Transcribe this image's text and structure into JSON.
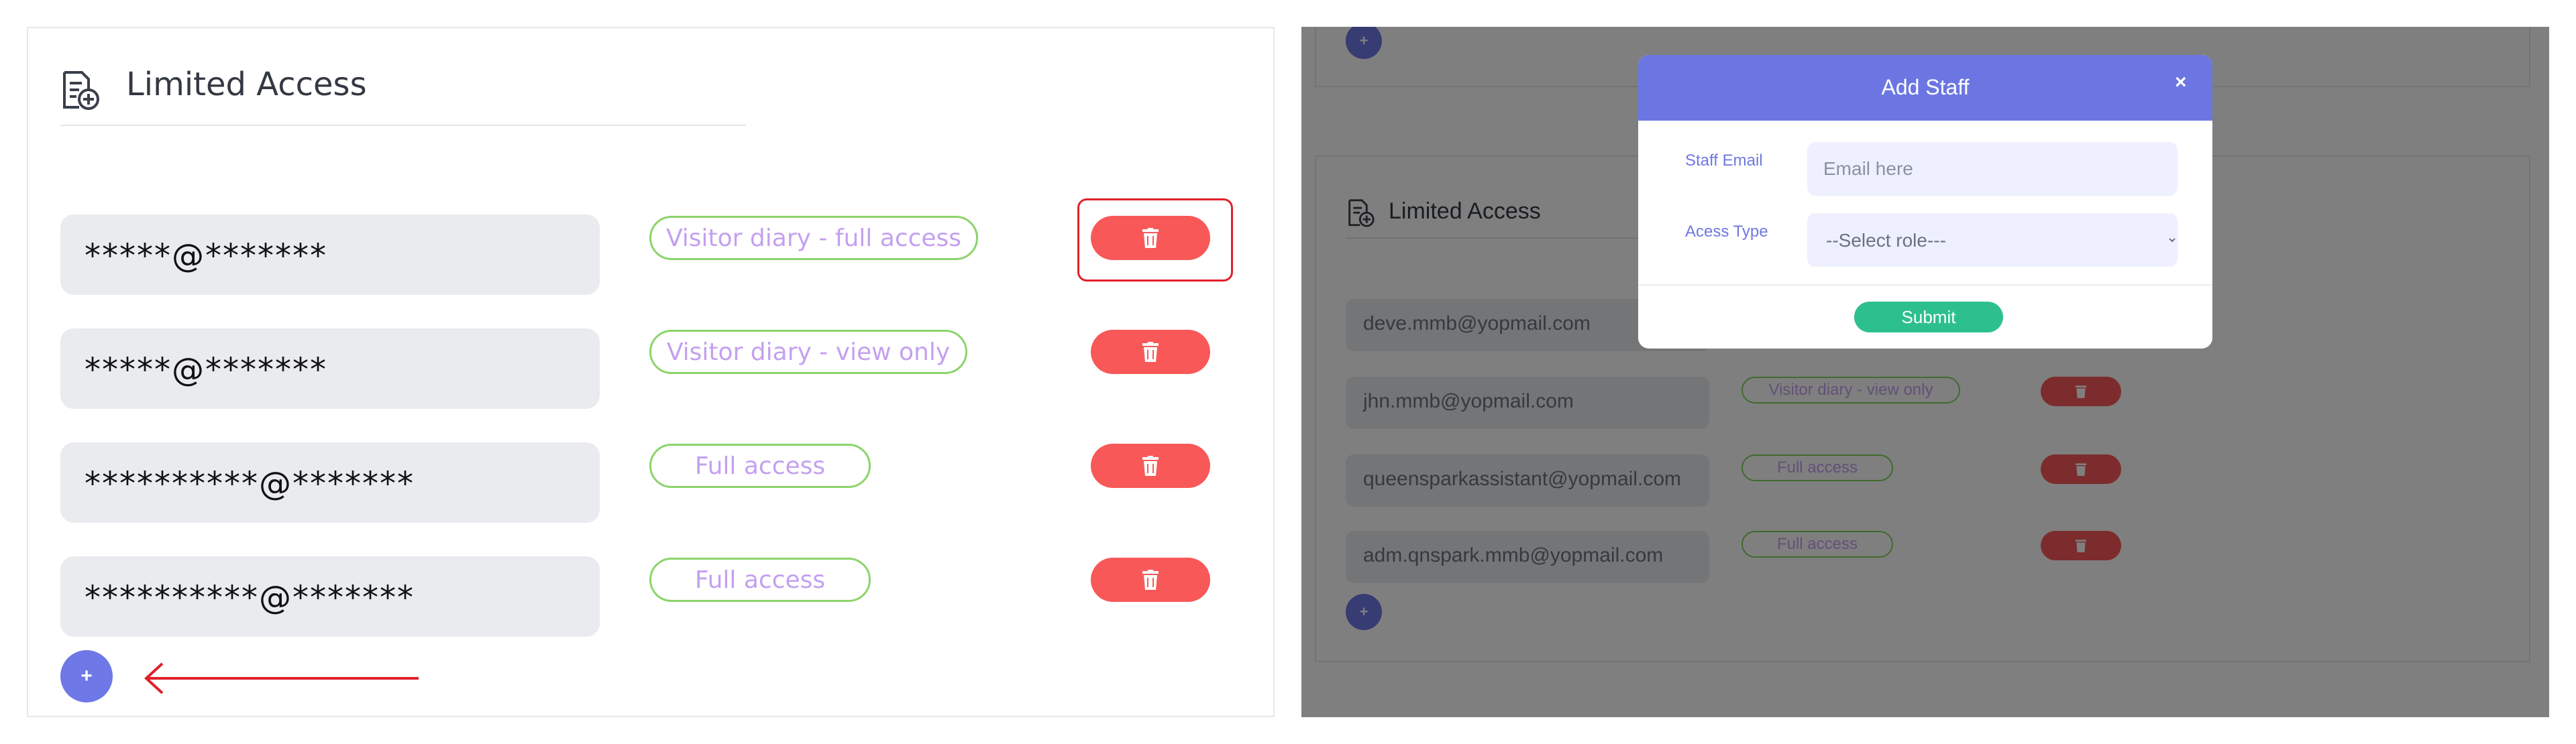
{
  "left": {
    "title": "Limited Access",
    "rows": [
      {
        "email": "*****@*******",
        "access": "Visitor diary - full access"
      },
      {
        "email": "*****@*******",
        "access": "Visitor diary - view only"
      },
      {
        "email": "**********@*******",
        "access": "Full access"
      },
      {
        "email": "**********@*******",
        "access": "Full access"
      }
    ],
    "add_label": "+",
    "delete_icon": "trash-icon"
  },
  "right": {
    "title": "Limited Access",
    "rows": [
      {
        "email": "deve.mmb@yopmail.com",
        "access": ""
      },
      {
        "email": "jhn.mmb@yopmail.com",
        "access": "Visitor diary - view only"
      },
      {
        "email": "queensparkassistant@yopmail.com",
        "access": "Full access"
      },
      {
        "email": "adm.qnspark.mmb@yopmail.com",
        "access": "Full access"
      }
    ],
    "add_label": "+",
    "modal": {
      "title": "Add Staff",
      "close": "×",
      "email_label": "Staff Email",
      "email_placeholder": "Email here",
      "access_label": "Acess Type",
      "access_selected": "--Select role---",
      "submit": "Submit"
    }
  },
  "colors": {
    "accent": "#6b76e2",
    "delete": "#f95858",
    "pill_border": "#8bd46b",
    "pill_text": "#c4a0f0",
    "submit": "#2dc08e",
    "highlight": "#e0202a"
  }
}
